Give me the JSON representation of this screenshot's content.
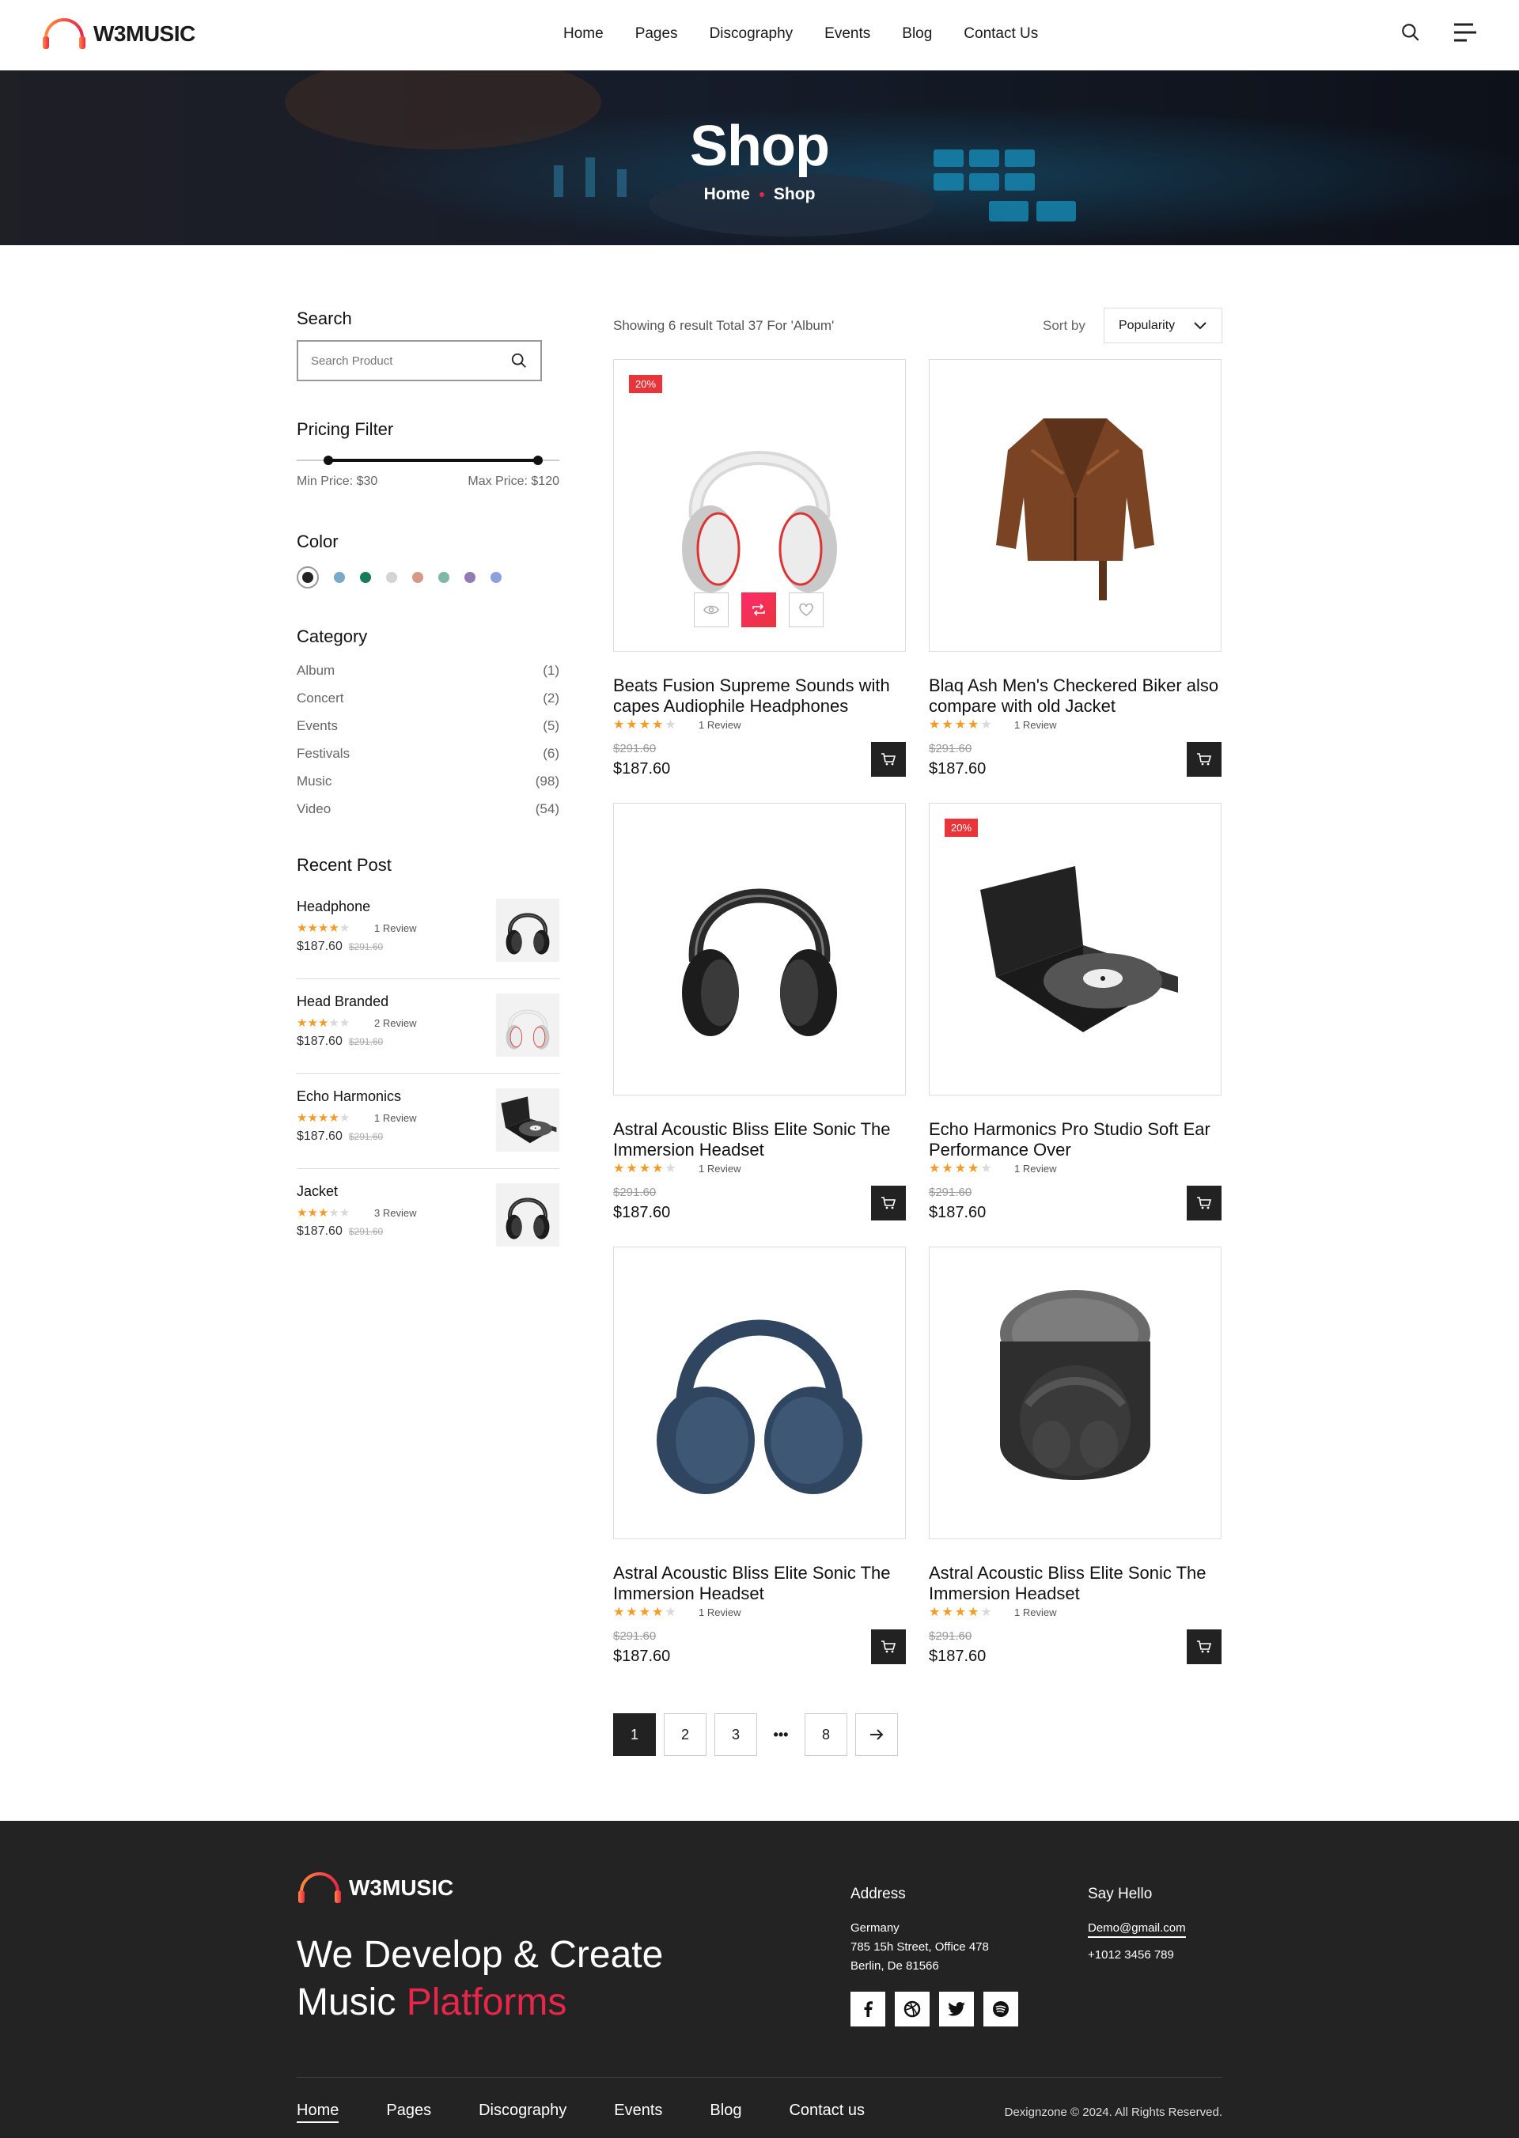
{
  "brand": {
    "name": "W3MUSIC",
    "accent": "#e8264a"
  },
  "nav": [
    "Home",
    "Pages",
    "Discography",
    "Events",
    "Blog",
    "Contact Us"
  ],
  "banner": {
    "title": "Shop",
    "crumbs": [
      "Home",
      "Shop"
    ]
  },
  "sidebar": {
    "search_title": "Search",
    "search_placeholder": "Search Product",
    "pricing_title": "Pricing Filter",
    "min_label": "Min Price:",
    "min_value": "$30",
    "max_label": "Max Price:",
    "max_value": "$120",
    "price_range_fraction": [
      0.12,
      0.92
    ],
    "color_title": "Color",
    "colors": [
      "#222222",
      "#7aa8c7",
      "#147a5a",
      "#d4d4d4",
      "#d89888",
      "#7fb7a8",
      "#8f7cb4",
      "#8fa0e0"
    ],
    "category_title": "Category",
    "categories": [
      {
        "name": "Album",
        "count": "(1)"
      },
      {
        "name": "Concert",
        "count": "(2)"
      },
      {
        "name": "Events",
        "count": "(5)"
      },
      {
        "name": "Festivals",
        "count": "(6)"
      },
      {
        "name": "Music",
        "count": "(98)"
      },
      {
        "name": "Video",
        "count": "(54)"
      }
    ],
    "recent_title": "Recent Post",
    "recent": [
      {
        "name": "Headphone",
        "stars": 4,
        "review": "1 Review",
        "price": "$187.60",
        "old": "$291.60"
      },
      {
        "name": "Head Branded",
        "stars": 3,
        "review": "2 Review",
        "price": "$187.60",
        "old": "$291.60"
      },
      {
        "name": "Echo Harmonics",
        "stars": 4,
        "review": "1 Review",
        "price": "$187.60",
        "old": "$291.60"
      },
      {
        "name": "Jacket",
        "stars": 3,
        "review": "3 Review",
        "price": "$187.60",
        "old": "$291.60"
      }
    ]
  },
  "results": {
    "text": "Showing 6 result Total 37 For 'Album'",
    "sort_label": "Sort by",
    "sort_value": "Popularity"
  },
  "products": [
    {
      "title": "Beats Fusion Supreme Sounds with capes Audiophile Headphones",
      "badge": "20%",
      "stars": 4,
      "review": "1 Review",
      "old": "$291.60",
      "price": "$187.60"
    },
    {
      "title": "Blaq Ash Men's Checkered Biker also compare with old Jacket",
      "badge": "",
      "stars": 4,
      "review": "1 Review",
      "old": "$291.60",
      "price": "$187.60"
    },
    {
      "title": "Astral Acoustic Bliss Elite Sonic The Immersion Headset",
      "badge": "",
      "stars": 4,
      "review": "1 Review",
      "old": "$291.60",
      "price": "$187.60"
    },
    {
      "title": "Echo Harmonics Pro Studio Soft Ear Performance Over",
      "badge": "20%",
      "stars": 4,
      "review": "1 Review",
      "old": "$291.60",
      "price": "$187.60"
    },
    {
      "title": "Astral Acoustic Bliss Elite Sonic The Immersion Headset",
      "badge": "",
      "stars": 4,
      "review": "1 Review",
      "old": "$291.60",
      "price": "$187.60"
    },
    {
      "title": "Astral Acoustic Bliss Elite Sonic The Immersion Headset",
      "badge": "",
      "stars": 4,
      "review": "1 Review",
      "old": "$291.60",
      "price": "$187.60"
    }
  ],
  "pagination": {
    "pages": [
      "1",
      "2",
      "3",
      "8"
    ],
    "ellipsis": "•••"
  },
  "footer": {
    "slogan_1": "We Develop & Create",
    "slogan_2a": "Music ",
    "slogan_2b": "Platforms",
    "address_title": "Address",
    "address": [
      "Germany",
      "785 15h Street, Office 478",
      "Berlin, De 81566"
    ],
    "hello_title": "Say Hello",
    "email": "Demo@gmail.com",
    "phone": "+1012 3456 789",
    "nav": [
      "Home",
      "Pages",
      "Discography",
      "Events",
      "Blog",
      "Contact us"
    ],
    "copyright": "Dexignzone © 2024. All Rights Reserved."
  }
}
